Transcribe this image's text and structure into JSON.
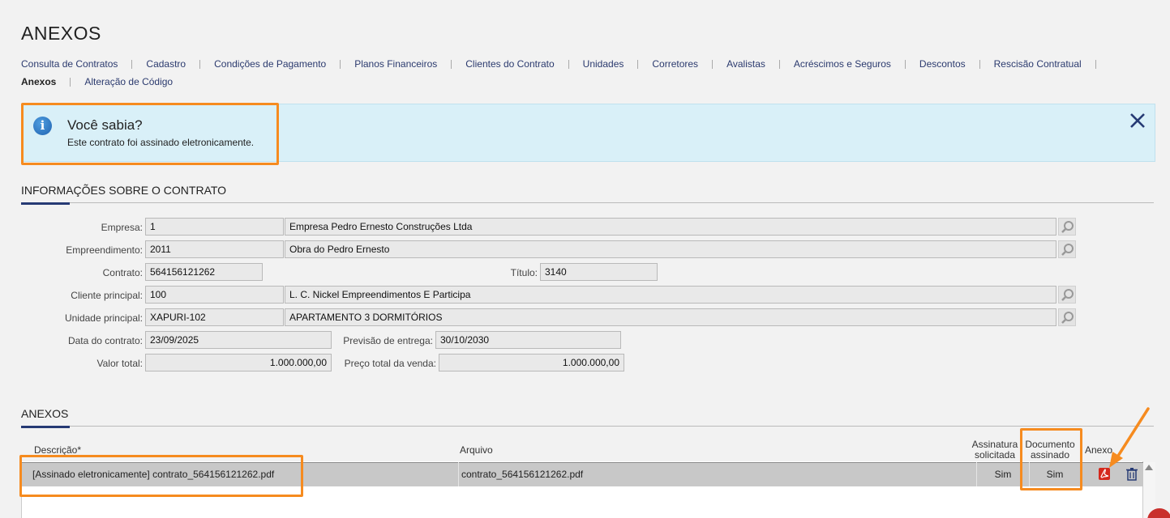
{
  "page": {
    "title": "ANEXOS"
  },
  "tabs": {
    "row1": [
      "Consulta de Contratos",
      "Cadastro",
      "Condições de Pagamento",
      "Planos Financeiros",
      "Clientes do Contrato",
      "Unidades",
      "Corretores",
      "Avalistas",
      "Acréscimos e Seguros",
      "Descontos",
      "Rescisão Contratual"
    ],
    "row2": [
      "Anexos",
      "Alteração de Código"
    ],
    "active": "Anexos"
  },
  "alert": {
    "title": "Você sabia?",
    "message": "Este contrato foi assinado eletronicamente.",
    "icon": "info-icon",
    "close_icon": "close-icon"
  },
  "contract_info": {
    "section_title": "INFORMAÇÕES SOBRE O CONTRATO",
    "empresa": {
      "label": "Empresa:",
      "code": "1",
      "name": "Empresa Pedro Ernesto Construções Ltda"
    },
    "empreendimento": {
      "label": "Empreendimento:",
      "code": "2011",
      "name": "Obra do Pedro Ernesto"
    },
    "contrato": {
      "label": "Contrato:",
      "value": "564156121262"
    },
    "titulo": {
      "label": "Título:",
      "value": "3140"
    },
    "cliente": {
      "label": "Cliente principal:",
      "code": "100",
      "name": "L. C. Nickel Empreendimentos E Participa"
    },
    "unidade": {
      "label": "Unidade principal:",
      "code": "XAPURI-102",
      "name": "APARTAMENTO 3 DORMITÓRIOS"
    },
    "data_contrato": {
      "label": "Data do contrato:",
      "value": "23/09/2025"
    },
    "previsao": {
      "label": "Previsão de entrega:",
      "value": "30/10/2030"
    },
    "valor_total": {
      "label": "Valor total:",
      "value": "1.000.000,00"
    },
    "preco_total": {
      "label": "Preço total da venda:",
      "value": "1.000.000,00"
    }
  },
  "attachments": {
    "section_title": "ANEXOS",
    "headers": {
      "descricao": "Descrição*",
      "arquivo": "Arquivo",
      "assinatura_1": "Assinatura",
      "assinatura_2": "solicitada",
      "documento_1": "Documento",
      "documento_2": "assinado",
      "anexo": "Anexo"
    },
    "rows": [
      {
        "descricao": "[Assinado eletronicamente] contrato_564156121262.pdf",
        "arquivo": "contrato_564156121262.pdf",
        "assinatura": "Sim",
        "documento": "Sim"
      }
    ]
  },
  "colors": {
    "accent": "#f68b1f",
    "nav": "#2b3a6e",
    "alert_bg": "#d9f0f8"
  }
}
